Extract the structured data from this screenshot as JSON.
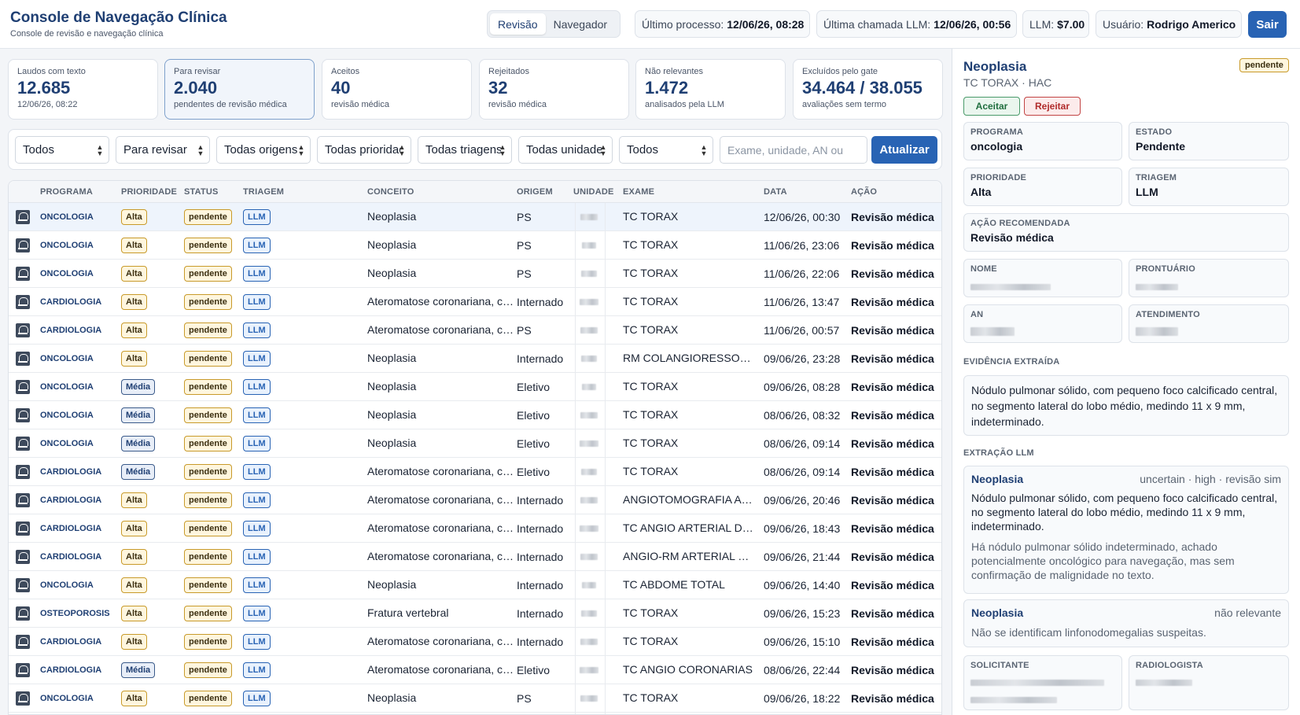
{
  "header": {
    "title": "Console de Navegação Clínica",
    "subtitle": "Console de revisão e navegação clínica",
    "tabs": [
      {
        "label": "Revisão",
        "active": true
      },
      {
        "label": "Navegador",
        "active": false
      }
    ],
    "ultimo_processo_label": "Último processo:",
    "ultimo_processo_value": "12/06/26, 08:28",
    "ultima_chamada_label": "Última chamada LLM:",
    "ultima_chamada_value": "12/06/26, 00:56",
    "llm_cost_label": "LLM:",
    "llm_cost_value": "$7.00",
    "usuario_label": "Usuário:",
    "usuario_value": "Rodrigo Americo",
    "logout_label": "Sair"
  },
  "kpis": [
    {
      "label": "Laudos com texto",
      "value": "12.685",
      "sub": "12/06/26, 08:22",
      "active": false
    },
    {
      "label": "Para revisar",
      "value": "2.040",
      "sub": "pendentes de revisão médica",
      "active": true
    },
    {
      "label": "Aceitos",
      "value": "40",
      "sub": "revisão médica",
      "active": false
    },
    {
      "label": "Rejeitados",
      "value": "32",
      "sub": "revisão médica",
      "active": false
    },
    {
      "label": "Não relevantes",
      "value": "1.472",
      "sub": "analisados pela LLM",
      "active": false
    },
    {
      "label": "Excluídos pelo gate",
      "value": "34.464 / 38.055",
      "sub": "avaliações sem termo",
      "active": false
    }
  ],
  "filters": {
    "selects": [
      "Todos",
      "Para revisar",
      "Todas origens",
      "Todas prioridades",
      "Todas triagens",
      "Todas unidades",
      "Todos"
    ],
    "search_placeholder": "Exame, unidade, AN ou",
    "refresh_label": "Atualizar"
  },
  "table": {
    "columns": [
      "PROGRAMA",
      "PRIORIDADE",
      "STATUS",
      "TRIAGEM",
      "CONCEITO",
      "ORIGEM",
      "UNIDADE",
      "EXAME",
      "DATA",
      "AÇÃO"
    ],
    "rows": [
      {
        "programa": "ONCOLOGIA",
        "prioridade": "Alta",
        "status": "pendente",
        "triagem": "LLM",
        "conceito": "Neoplasia",
        "origem": "PS",
        "exame": "TC TORAX",
        "data": "12/06/26, 00:30",
        "acao": "Revisão médica"
      },
      {
        "programa": "ONCOLOGIA",
        "prioridade": "Alta",
        "status": "pendente",
        "triagem": "LLM",
        "conceito": "Neoplasia",
        "origem": "PS",
        "exame": "TC TORAX",
        "data": "11/06/26, 23:06",
        "acao": "Revisão médica"
      },
      {
        "programa": "ONCOLOGIA",
        "prioridade": "Alta",
        "status": "pendente",
        "triagem": "LLM",
        "conceito": "Neoplasia",
        "origem": "PS",
        "exame": "TC TORAX",
        "data": "11/06/26, 22:06",
        "acao": "Revisão médica"
      },
      {
        "programa": "CARDIOLOGIA",
        "prioridade": "Alta",
        "status": "pendente",
        "triagem": "LLM",
        "conceito": "Ateromatose coronariana, calcificação",
        "origem": "Internado",
        "exame": "TC TORAX",
        "data": "11/06/26, 13:47",
        "acao": "Revisão médica"
      },
      {
        "programa": "CARDIOLOGIA",
        "prioridade": "Alta",
        "status": "pendente",
        "triagem": "LLM",
        "conceito": "Ateromatose coronariana, calcificação",
        "origem": "PS",
        "exame": "TC TORAX",
        "data": "11/06/26, 00:57",
        "acao": "Revisão médica"
      },
      {
        "programa": "ONCOLOGIA",
        "prioridade": "Alta",
        "status": "pendente",
        "triagem": "LLM",
        "conceito": "Neoplasia",
        "origem": "Internado",
        "exame": "RM COLANGIORESSONANCIA",
        "data": "09/06/26, 23:28",
        "acao": "Revisão médica"
      },
      {
        "programa": "ONCOLOGIA",
        "prioridade": "Média",
        "status": "pendente",
        "triagem": "LLM",
        "conceito": "Neoplasia",
        "origem": "Eletivo",
        "exame": "TC TORAX",
        "data": "09/06/26, 08:28",
        "acao": "Revisão médica"
      },
      {
        "programa": "ONCOLOGIA",
        "prioridade": "Média",
        "status": "pendente",
        "triagem": "LLM",
        "conceito": "Neoplasia",
        "origem": "Eletivo",
        "exame": "TC TORAX",
        "data": "08/06/26, 08:32",
        "acao": "Revisão médica"
      },
      {
        "programa": "ONCOLOGIA",
        "prioridade": "Média",
        "status": "pendente",
        "triagem": "LLM",
        "conceito": "Neoplasia",
        "origem": "Eletivo",
        "exame": "TC TORAX",
        "data": "08/06/26, 09:14",
        "acao": "Revisão médica"
      },
      {
        "programa": "CARDIOLOGIA",
        "prioridade": "Média",
        "status": "pendente",
        "triagem": "LLM",
        "conceito": "Ateromatose coronariana, calcificação",
        "origem": "Eletivo",
        "exame": "TC TORAX",
        "data": "08/06/26, 09:14",
        "acao": "Revisão médica"
      },
      {
        "programa": "CARDIOLOGIA",
        "prioridade": "Alta",
        "status": "pendente",
        "triagem": "LLM",
        "conceito": "Ateromatose coronariana, calcificação",
        "origem": "Internado",
        "exame": "ANGIOTOMOGRAFIA ARTERIAL",
        "data": "09/06/26, 20:46",
        "acao": "Revisão médica"
      },
      {
        "programa": "CARDIOLOGIA",
        "prioridade": "Alta",
        "status": "pendente",
        "triagem": "LLM",
        "conceito": "Ateromatose coronariana, calcificação",
        "origem": "Internado",
        "exame": "TC ANGIO ARTERIAL DE AORTA",
        "data": "09/06/26, 18:43",
        "acao": "Revisão médica"
      },
      {
        "programa": "CARDIOLOGIA",
        "prioridade": "Alta",
        "status": "pendente",
        "triagem": "LLM",
        "conceito": "Ateromatose coronariana, calcificação",
        "origem": "Internado",
        "exame": "ANGIO-RM ARTERIAL DE AORTA",
        "data": "09/06/26, 21:44",
        "acao": "Revisão médica"
      },
      {
        "programa": "ONCOLOGIA",
        "prioridade": "Alta",
        "status": "pendente",
        "triagem": "LLM",
        "conceito": "Neoplasia",
        "origem": "Internado",
        "exame": "TC ABDOME TOTAL",
        "data": "09/06/26, 14:40",
        "acao": "Revisão médica"
      },
      {
        "programa": "OSTEOPOROSIS",
        "prioridade": "Alta",
        "status": "pendente",
        "triagem": "LLM",
        "conceito": "Fratura vertebral",
        "origem": "Internado",
        "exame": "TC TORAX",
        "data": "09/06/26, 15:23",
        "acao": "Revisão médica"
      },
      {
        "programa": "CARDIOLOGIA",
        "prioridade": "Alta",
        "status": "pendente",
        "triagem": "LLM",
        "conceito": "Ateromatose coronariana, calcificação",
        "origem": "Internado",
        "exame": "TC TORAX",
        "data": "09/06/26, 15:10",
        "acao": "Revisão médica"
      },
      {
        "programa": "CARDIOLOGIA",
        "prioridade": "Média",
        "status": "pendente",
        "triagem": "LLM",
        "conceito": "Ateromatose coronariana, calcificação",
        "origem": "Eletivo",
        "exame": "TC ANGIO CORONARIAS",
        "data": "08/06/26, 22:44",
        "acao": "Revisão médica"
      },
      {
        "programa": "ONCOLOGIA",
        "prioridade": "Alta",
        "status": "pendente",
        "triagem": "LLM",
        "conceito": "Neoplasia",
        "origem": "PS",
        "exame": "TC TORAX",
        "data": "09/06/26, 18:22",
        "acao": "Revisão médica"
      }
    ]
  },
  "panel": {
    "title": "Neoplasia",
    "subtitle": "TC TORAX · HAC",
    "status_badge": "pendente",
    "accept_label": "Aceitar",
    "reject_label": "Rejeitar",
    "fields": {
      "programa_label": "PROGRAMA",
      "programa_value": "oncologia",
      "estado_label": "ESTADO",
      "estado_value": "Pendente",
      "prioridade_label": "PRIORIDADE",
      "prioridade_value": "Alta",
      "triagem_label": "TRIAGEM",
      "triagem_value": "LLM",
      "acao_label": "AÇÃO RECOMENDADA",
      "acao_value": "Revisão médica",
      "nome_label": "NOME",
      "prontuario_label": "PRONTUÁRIO",
      "an_label": "AN",
      "atendimento_label": "ATENDIMENTO",
      "solicitante_label": "SOLICITANTE",
      "radiologista_label": "RADIOLOGISTA"
    },
    "evidence_label": "EVIDÊNCIA EXTRAÍDA",
    "evidence_text": "Nódulo pulmonar sólido, com pequeno foco calcificado central, no segmento lateral do lobo médio, medindo 11 x 9 mm, indeterminado.",
    "llm_label": "EXTRAÇÃO LLM",
    "llm_items": [
      {
        "name": "Neoplasia",
        "meta": "uncertain · high · revisão sim",
        "text": "Nódulo pulmonar sólido, com pequeno foco calcificado central, no segmento lateral do lobo médio, medindo 11 x 9 mm, indeterminado.",
        "reason": "Há nódulo pulmonar sólido indeterminado, achado potencialmente oncológico para navegação, mas sem confirmação de malignidade no texto."
      },
      {
        "name": "Neoplasia",
        "meta": "não relevante",
        "text": "Não se identificam linfonodomegalias suspeitas."
      }
    ]
  }
}
